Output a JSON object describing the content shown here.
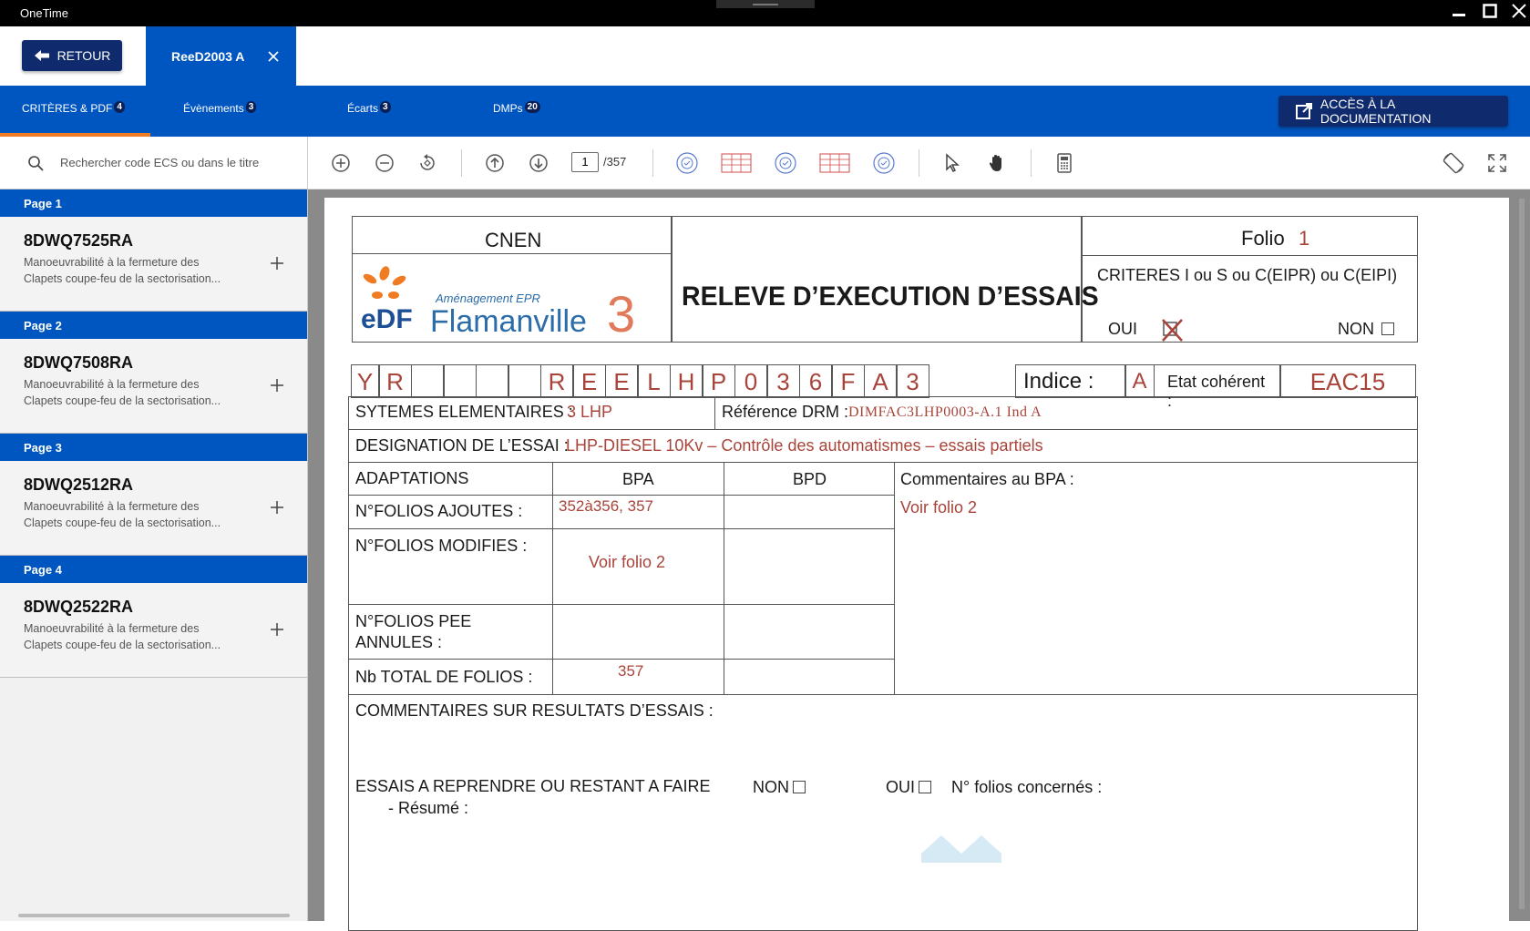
{
  "window": {
    "app_title": "OneTime"
  },
  "topbar": {
    "back_label": "RETOUR",
    "doc_tab_label": "ReeD2003 A"
  },
  "nav": {
    "tabs": [
      {
        "label": "CRITÈRES & PDF",
        "badge": "4"
      },
      {
        "label": "Évènements",
        "badge": "3"
      },
      {
        "label": "Écarts",
        "badge": "3"
      },
      {
        "label": "DMPs",
        "badge": "20"
      }
    ],
    "doc_button_label": "ACCÈS À LA DOCUMENTATION"
  },
  "sidebar": {
    "search_placeholder": "Rechercher code ECS ou dans le titre",
    "pages": [
      {
        "header": "Page 1",
        "code": "8DWQ7525RA",
        "desc1": "Manoeuvrabilité à la fermeture des",
        "desc2": "Clapets coupe-feu de la sectorisation..."
      },
      {
        "header": "Page 2",
        "code": "8DWQ7508RA",
        "desc1": "Manoeuvrabilité à la fermeture des",
        "desc2": "Clapets coupe-feu de la sectorisation..."
      },
      {
        "header": "Page 3",
        "code": "8DWQ2512RA",
        "desc1": "Manoeuvrabilité à la fermeture des",
        "desc2": "Clapets coupe-feu de la sectorisation..."
      },
      {
        "header": "Page 4",
        "code": "8DWQ2522RA",
        "desc1": "Manoeuvrabilité à la fermeture des",
        "desc2": "Clapets coupe-feu de la sectorisation..."
      }
    ]
  },
  "toolbar": {
    "current_page": "1",
    "total_pages": "/357"
  },
  "document": {
    "cnen": "CNEN",
    "logo_edf": "eDF",
    "logo_sub": "Aménagement EPR",
    "logo_name": "Flamanville",
    "logo_num": "3",
    "title": "RELEVE D’EXECUTION D’ESSAIS",
    "folio_label": "Folio",
    "folio_value": "1",
    "criteres": "CRITERES  I ou S ou C(EIPR) ou C(EIPI)",
    "oui": "OUI",
    "non": "NON",
    "code_cells": [
      "Y",
      "R",
      "",
      "",
      "",
      "",
      "R",
      "E",
      "E",
      "L",
      "H",
      "P",
      "0",
      "3",
      "6",
      "F",
      "A",
      "3"
    ],
    "indice_label": "Indice :",
    "indice_value": "A",
    "etat_label": "Etat cohérent :",
    "etat_value": "EAC15",
    "systemes_label": "SYTEMES ELEMENTAIRES :",
    "systemes_value": "3 LHP",
    "ref_label": "Référence DRM :",
    "ref_value": "DIMFAC3LHP0003-A.1 Ind A",
    "designation_label": "DESIGNATION DE L’ESSAI :",
    "designation_value": "LHP-DIESEL 10Kv – Contrôle des automatismes – essais partiels",
    "adaptations": "ADAPTATIONS",
    "bpa": "BPA",
    "bpd": "BPD",
    "comm_bpa_label": "Commentaires au BPA :",
    "comm_bpa_value": "Voir folio 2",
    "folios_ajoutes_label": "N°FOLIOS AJOUTES :",
    "folios_ajoutes_value": "352à356, 357",
    "folios_modifies_label": "N°FOLIOS MODIFIES :",
    "folios_modifies_value": "Voir folio 2",
    "folios_pee_label1": "N°FOLIOS PEE",
    "folios_pee_label2": "ANNULES :",
    "nb_total_label": "Nb TOTAL DE FOLIOS :",
    "nb_total_value": "357",
    "comm_resultats": "COMMENTAIRES SUR RESULTATS D’ESSAIS :",
    "essais_reprendre": "ESSAIS A REPRENDRE OU RESTANT A FAIRE",
    "non2": "NON",
    "oui2": "OUI",
    "folios_concernes": "N° folios concernés :",
    "resume": "-   Résumé :"
  },
  "colors": {
    "primary": "#0056c0",
    "dark": "#0f2b6e",
    "accent": "#f07b22",
    "handwriting": "#a8443a"
  }
}
